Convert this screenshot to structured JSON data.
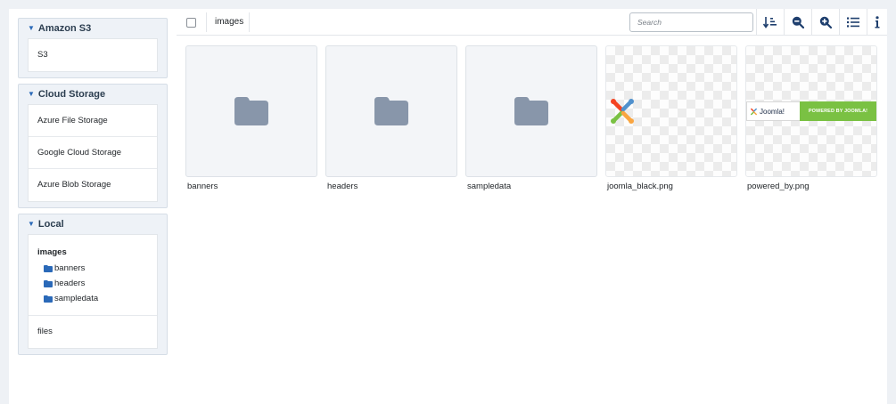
{
  "sidebar": {
    "panels": [
      {
        "title": "Amazon S3",
        "drives": [
          "S3"
        ]
      },
      {
        "title": "Cloud Storage",
        "drives": [
          "Azure File Storage",
          "Google Cloud Storage",
          "Azure Blob Storage"
        ]
      },
      {
        "title": "Local",
        "root": "images",
        "folders": [
          "banners",
          "headers",
          "sampledata"
        ],
        "extra_drive": "files"
      }
    ],
    "folder_icon_color": "#2a69b8"
  },
  "toolbar": {
    "breadcrumb": "images",
    "search_placeholder": "Search",
    "buttons": [
      "sort-icon",
      "zoom-out-icon",
      "zoom-in-icon",
      "list-view-icon",
      "info-icon"
    ],
    "icon_color": "#1f3f6e"
  },
  "items": [
    {
      "name": "banners",
      "type": "folder"
    },
    {
      "name": "headers",
      "type": "folder"
    },
    {
      "name": "sampledata",
      "type": "folder"
    },
    {
      "name": "joomla_black.png",
      "type": "image"
    },
    {
      "name": "powered_by.png",
      "type": "image",
      "banner_logo_text": "Joomla!",
      "banner_text": "POWERED BY JOOMLA!"
    }
  ],
  "colors": {
    "folder_tile_icon": "#8896aa",
    "accent": "#2a69b8",
    "powered_green": "#7ac143"
  }
}
